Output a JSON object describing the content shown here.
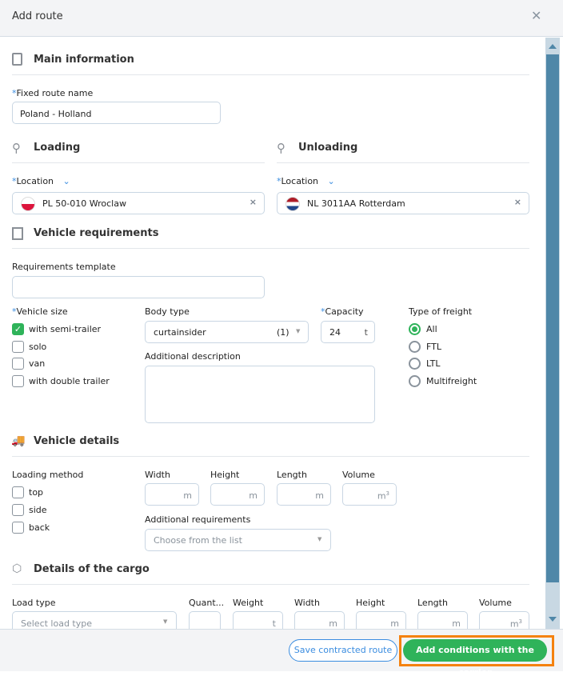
{
  "dialog": {
    "title": "Add route"
  },
  "main": {
    "heading": "Main information",
    "route_name_label": "Fixed route name",
    "route_name_value": "Poland - Holland"
  },
  "loading": {
    "heading": "Loading",
    "location_label": "Location",
    "location_value": "PL 50-010 Wroclaw"
  },
  "unloading": {
    "heading": "Unloading",
    "location_label": "Location",
    "location_value": "NL 3011AA Rotterdam"
  },
  "vehicle_req": {
    "heading": "Vehicle requirements",
    "template_label": "Requirements template",
    "template_value": "",
    "size_label": "Vehicle size",
    "sizes": [
      {
        "label": "with semi-trailer",
        "checked": true
      },
      {
        "label": "solo",
        "checked": false
      },
      {
        "label": "van",
        "checked": false
      },
      {
        "label": "with double trailer",
        "checked": false
      }
    ],
    "body_type_label": "Body type",
    "body_type_value": "curtainsider",
    "body_type_count": "(1)",
    "capacity_label": "Capacity",
    "capacity_value": "24",
    "capacity_unit": "t",
    "desc_label": "Additional description",
    "freight_label": "Type of freight",
    "freights": [
      {
        "label": "All",
        "selected": true
      },
      {
        "label": "FTL",
        "selected": false
      },
      {
        "label": "LTL",
        "selected": false
      },
      {
        "label": "Multifreight",
        "selected": false
      }
    ]
  },
  "vehicle_details": {
    "heading": "Vehicle details",
    "method_label": "Loading method",
    "methods": [
      {
        "label": "top"
      },
      {
        "label": "side"
      },
      {
        "label": "back"
      }
    ],
    "width_label": "Width",
    "height_label": "Height",
    "length_label": "Length",
    "volume_label": "Volume",
    "unit_m": "m",
    "unit_m3": "m",
    "sup3": "3",
    "addreq_label": "Additional requirements",
    "addreq_placeholder": "Choose from the list"
  },
  "cargo": {
    "heading": "Details of the cargo",
    "load_type_label": "Load type",
    "load_type_placeholder": "Select load type",
    "quantity_label": "Quant...",
    "weight_label": "Weight",
    "weight_unit": "t",
    "width_label": "Width",
    "height_label": "Height",
    "length_label": "Length",
    "volume_label": "Volume",
    "unit_m": "m",
    "sup3": "3"
  },
  "footer": {
    "save_label": "Save contracted route",
    "add_label": "Add conditions with the carrier"
  },
  "colors": {
    "accent": "#2fb35a",
    "link": "#3b8de0",
    "scrollbar": "#4f87a8",
    "highlight": "#f5820f"
  }
}
